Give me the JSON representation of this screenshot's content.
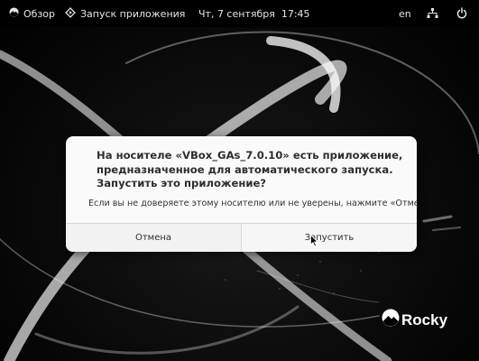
{
  "topbar": {
    "overview_label": "Обзор",
    "app_label": "Запуск приложения",
    "clock": "Чт, 7 сентября  17:45",
    "lang": "en",
    "icons": {
      "overview": "rocky-icon",
      "app": "autorun-icon",
      "network": "network-icon",
      "power": "power-icon"
    }
  },
  "dialog": {
    "heading": "На носителе «VBox_GAs_7.0.10» есть приложение, предназначенное для автоматического запуска. Запустить это приложение?",
    "body": "Если вы не доверяете этому носителю или не уверены, нажмите «Отмена».",
    "cancel_label": "Отмена",
    "run_label": "Запустить"
  },
  "branding": {
    "logo_text": "Rocky",
    "logo_icon": "rocky-logo-icon"
  },
  "colors": {
    "topbar_bg": "#000000",
    "dialog_bg": "#fafafa",
    "text": "#2e2e2e"
  }
}
